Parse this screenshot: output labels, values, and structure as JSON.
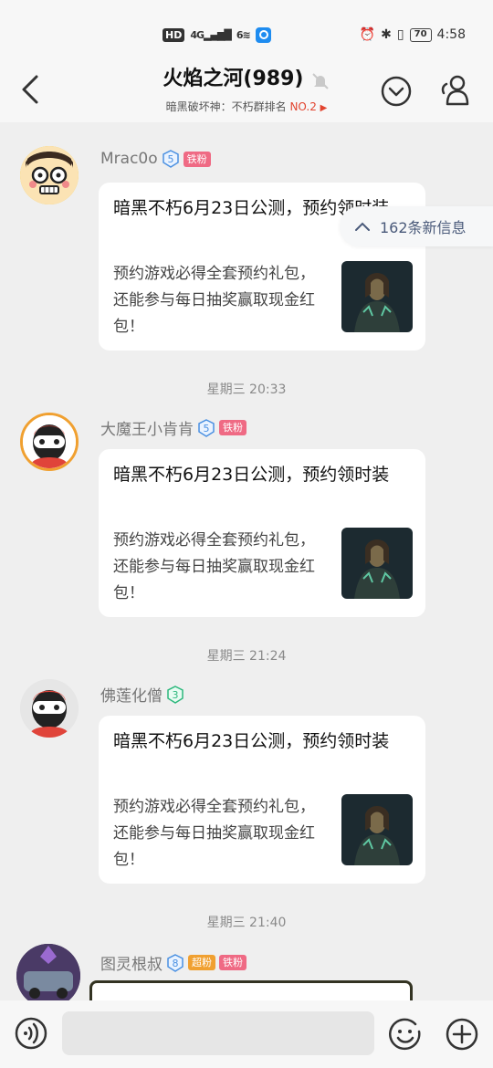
{
  "status_bar": {
    "network": "HD",
    "signal_text": "4G",
    "wifi_text": "6",
    "battery": "70",
    "time": "4:58"
  },
  "header": {
    "title": "火焰之河(989)",
    "subtitle_prefix": "暗黑破坏神：不朽群排名",
    "subtitle_rank": "NO.2"
  },
  "new_messages": {
    "label": "162条新信息"
  },
  "messages": [
    {
      "sender": "Mrac0o",
      "level": "5",
      "badges": [
        "铁粉"
      ],
      "card_title": "暗黑不朽6月23日公测，预约领时装",
      "card_desc": "预约游戏必得全套预约礼包，还能参与每日抽奖赢取现金红包！"
    },
    {
      "timestamp": "星期三 20:33",
      "sender": "大魔王小肯肯",
      "level": "5",
      "badges": [
        "铁粉"
      ],
      "card_title": "暗黑不朽6月23日公测，预约领时装",
      "card_desc": "预约游戏必得全套预约礼包，还能参与每日抽奖赢取现金红包！"
    },
    {
      "timestamp": "星期三 21:24",
      "sender": "佛莲化僧",
      "level": "3",
      "badges": [],
      "card_title": "暗黑不朽6月23日公测，预约领时装",
      "card_desc": "预约游戏必得全套预约礼包，还能参与每日抽奖赢取现金红包！"
    },
    {
      "timestamp": "星期三 21:40",
      "sender": "图灵根叔",
      "level": "8",
      "badges": [
        "超粉",
        "铁粉"
      ]
    }
  ],
  "colors": {
    "accent_red": "#e2442f",
    "badge_pink": "#ef6a84",
    "badge_gold": "#f0a030",
    "level_blue": "#4a90e2",
    "level_green": "#2db87d"
  }
}
